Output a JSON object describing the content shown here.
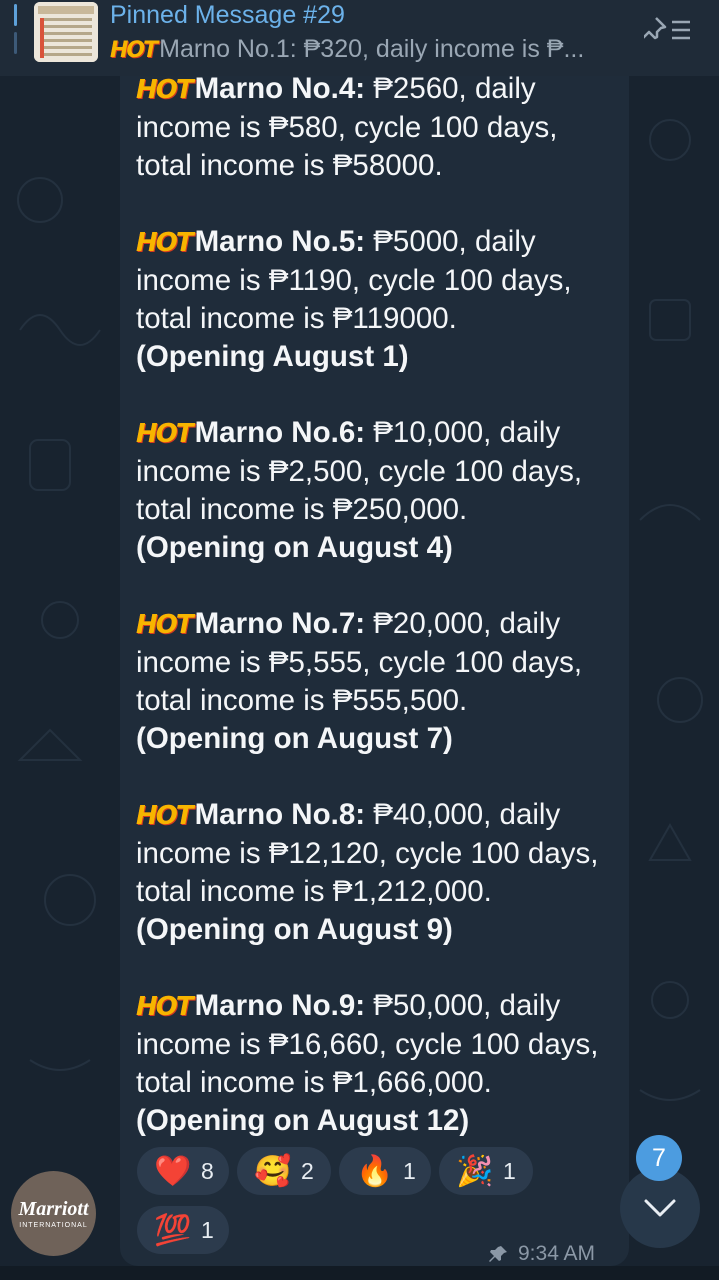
{
  "pinned": {
    "title": "Pinned Message #29",
    "hot_label": "HOT",
    "preview": "Marno No.1: ₱320, daily income is ₱..."
  },
  "message": {
    "hot_label": "HOT",
    "entries": [
      {
        "name": "Marno No.4:",
        "text": " ₱2560, daily income is ₱580, cycle 100 days, total income is ₱58000.",
        "opening": ""
      },
      {
        "name": "Marno No.5:",
        "text": " ₱5000, daily income is ₱1190, cycle 100 days, total income is ₱119000.",
        "opening": "(Opening August 1)"
      },
      {
        "name": "Marno No.6:",
        "text": " ₱10,000, daily income is ₱2,500, cycle 100 days, total income is ₱250,000.",
        "opening": "(Opening on August 4)"
      },
      {
        "name": "Marno No.7:",
        "text": " ₱20,000, daily income is ₱5,555, cycle 100 days, total income is ₱555,500.",
        "opening": "(Opening on August 7)"
      },
      {
        "name": "Marno No.8:",
        "text": " ₱40,000, daily income is ₱12,120, cycle 100 days, total income is ₱1,212,000.",
        "opening": "(Opening on August 9)"
      },
      {
        "name": "Marno No.9:",
        "text": " ₱50,000, daily income is ₱16,660, cycle 100 days, total income is ₱1,666,000.",
        "opening": "(Opening on August 12)"
      }
    ],
    "time": "9:34 AM"
  },
  "reactions": [
    {
      "emoji": "❤️",
      "count": "8"
    },
    {
      "emoji": "🥰",
      "count": "2"
    },
    {
      "emoji": "🔥",
      "count": "1"
    },
    {
      "emoji": "🎉",
      "count": "1"
    },
    {
      "emoji": "💯",
      "count": "1"
    }
  ],
  "avatar": {
    "brand": "Marriott",
    "sub": "INTERNATIONAL"
  },
  "scroll": {
    "unread_count": "7"
  },
  "colors": {
    "accent": "#6cb2ea",
    "bubble": "#1f2c3a",
    "badge": "#4c9ce0"
  }
}
